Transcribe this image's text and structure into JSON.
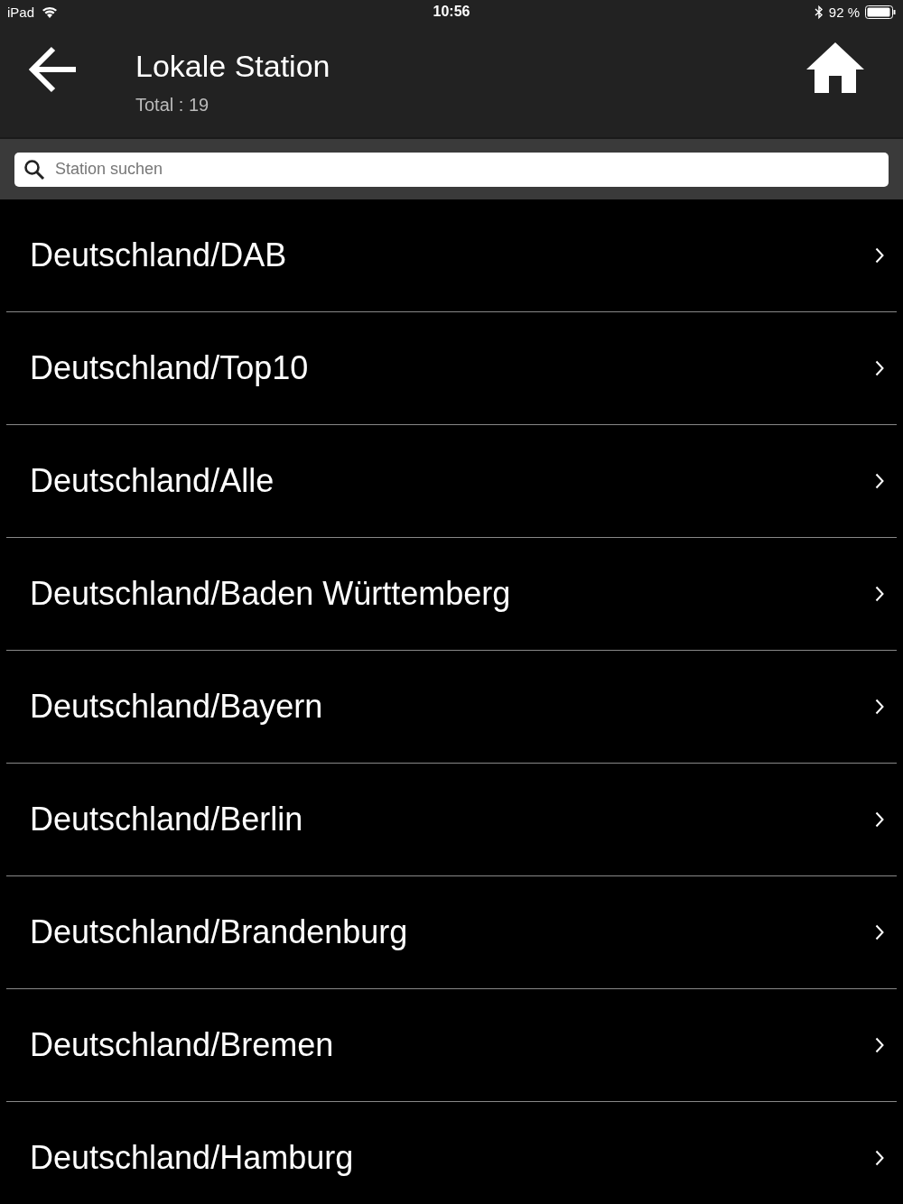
{
  "status_bar": {
    "device": "iPad",
    "time": "10:56",
    "battery": "92 %"
  },
  "header": {
    "title": "Lokale Station",
    "subtitle": "Total : 19"
  },
  "search": {
    "placeholder": "Station suchen"
  },
  "items": [
    {
      "label": "Deutschland/DAB"
    },
    {
      "label": "Deutschland/Top10"
    },
    {
      "label": "Deutschland/Alle"
    },
    {
      "label": "Deutschland/Baden Württemberg"
    },
    {
      "label": "Deutschland/Bayern"
    },
    {
      "label": "Deutschland/Berlin"
    },
    {
      "label": "Deutschland/Brandenburg"
    },
    {
      "label": "Deutschland/Bremen"
    },
    {
      "label": "Deutschland/Hamburg"
    }
  ]
}
